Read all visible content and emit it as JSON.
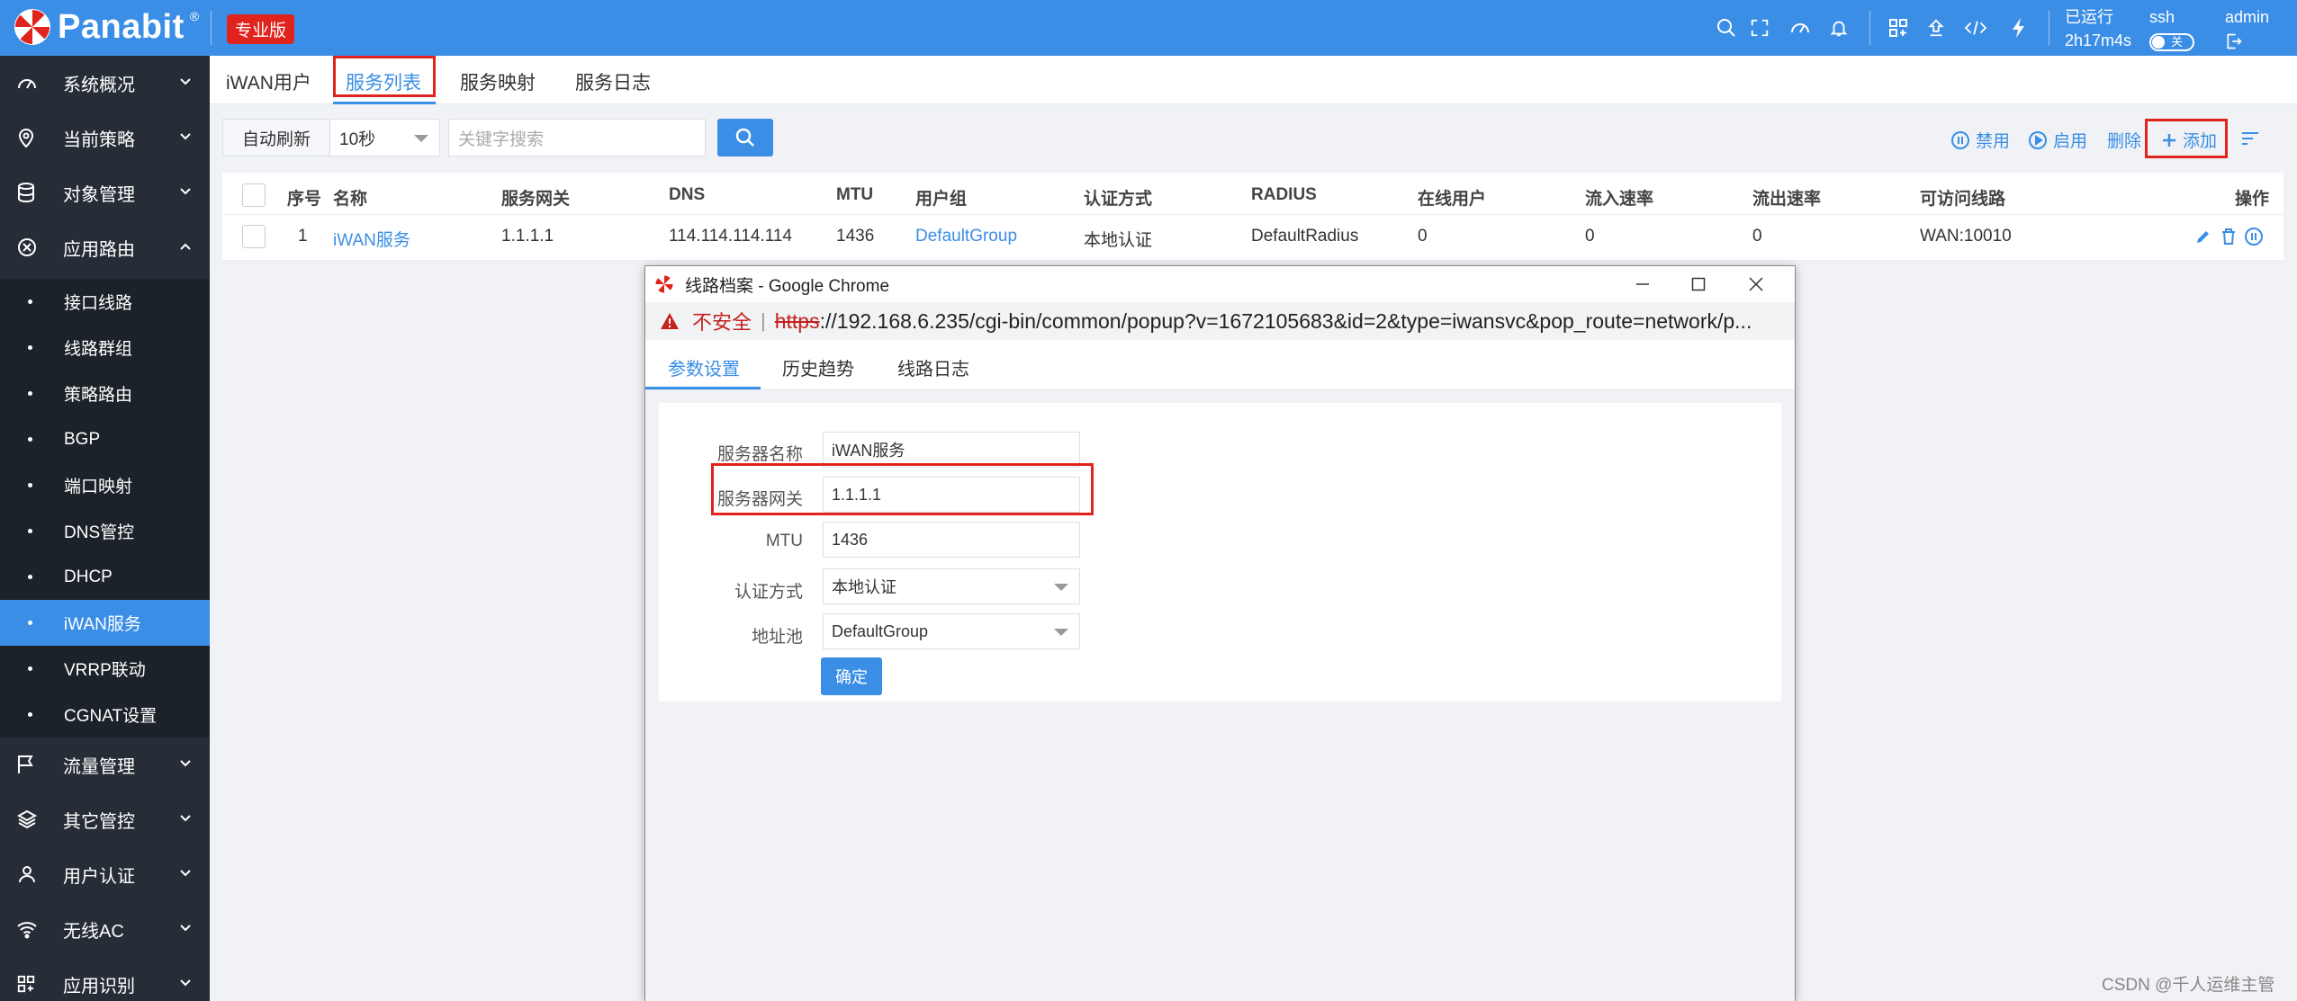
{
  "topbar": {
    "logo": "Panabit",
    "logo_reg": "®",
    "edition": "专业版",
    "uptime_label": "已运行",
    "uptime_value": "2h17m4s",
    "ssh_label": "ssh",
    "ssh_toggle": "关",
    "admin": "admin"
  },
  "sidebar": {
    "items_top": [
      {
        "label": "系统概况",
        "icon": "dashboard-icon"
      },
      {
        "label": "当前策略",
        "icon": "location-pin-icon"
      },
      {
        "label": "对象管理",
        "icon": "database-icon"
      },
      {
        "label": "应用路由",
        "icon": "route-icon"
      }
    ],
    "sub_items": [
      {
        "label": "接口线路"
      },
      {
        "label": "线路群组"
      },
      {
        "label": "策略路由"
      },
      {
        "label": "BGP"
      },
      {
        "label": "端口映射"
      },
      {
        "label": "DNS管控"
      },
      {
        "label": "DHCP"
      },
      {
        "label": "iWAN服务"
      },
      {
        "label": "VRRP联动"
      },
      {
        "label": "CGNAT设置"
      }
    ],
    "items_bottom": [
      {
        "label": "流量管理",
        "icon": "flag-icon"
      },
      {
        "label": "其它管控",
        "icon": "layers-icon"
      },
      {
        "label": "用户认证",
        "icon": "user-icon"
      },
      {
        "label": "无线AC",
        "icon": "wifi-icon"
      },
      {
        "label": "应用识别",
        "icon": "apps-icon"
      }
    ]
  },
  "tabs": [
    {
      "label": "iWAN用户"
    },
    {
      "label": "服务列表"
    },
    {
      "label": "服务映射"
    },
    {
      "label": "服务日志"
    }
  ],
  "toolbar": {
    "refresh_label": "自动刷新",
    "interval": "10秒",
    "search_placeholder": "关键字搜索",
    "disable": "禁用",
    "enable": "启用",
    "delete": "删除",
    "add": "添加"
  },
  "table": {
    "headers": [
      "序号",
      "名称",
      "服务网关",
      "DNS",
      "MTU",
      "用户组",
      "认证方式",
      "RADIUS",
      "在线用户",
      "流入速率",
      "流出速率",
      "可访问线路",
      "操作"
    ],
    "rows": [
      {
        "index": "1",
        "name": "iWAN服务",
        "gateway": "1.1.1.1",
        "dns": "114.114.114.114",
        "mtu": "1436",
        "group": "DefaultGroup",
        "auth": "本地认证",
        "radius": "DefaultRadius",
        "online": "0",
        "in_rate": "0",
        "out_rate": "0",
        "lines": "WAN:10010"
      }
    ]
  },
  "popup": {
    "title": "线路档案 - Google Chrome",
    "insecure": "不安全",
    "url_scheme": "https",
    "url_rest": "://192.168.6.235/cgi-bin/common/popup?v=1672105683&id=2&type=iwansvc&pop_route=network/p...",
    "tabs": [
      "参数设置",
      "历史趋势",
      "线路日志"
    ],
    "form": {
      "name_label": "服务器名称",
      "name_value": "iWAN服务",
      "gateway_label": "服务器网关",
      "gateway_value": "1.1.1.1",
      "mtu_label": "MTU",
      "mtu_value": "1436",
      "auth_label": "认证方式",
      "auth_value": "本地认证",
      "pool_label": "地址池",
      "pool_value": "DefaultGroup",
      "ok": "确定"
    }
  },
  "watermark": "CSDN @千人运维主管",
  "colors": {
    "primary": "#3a8ee6",
    "sidebar": "#262d36",
    "danger": "#e0231c"
  }
}
